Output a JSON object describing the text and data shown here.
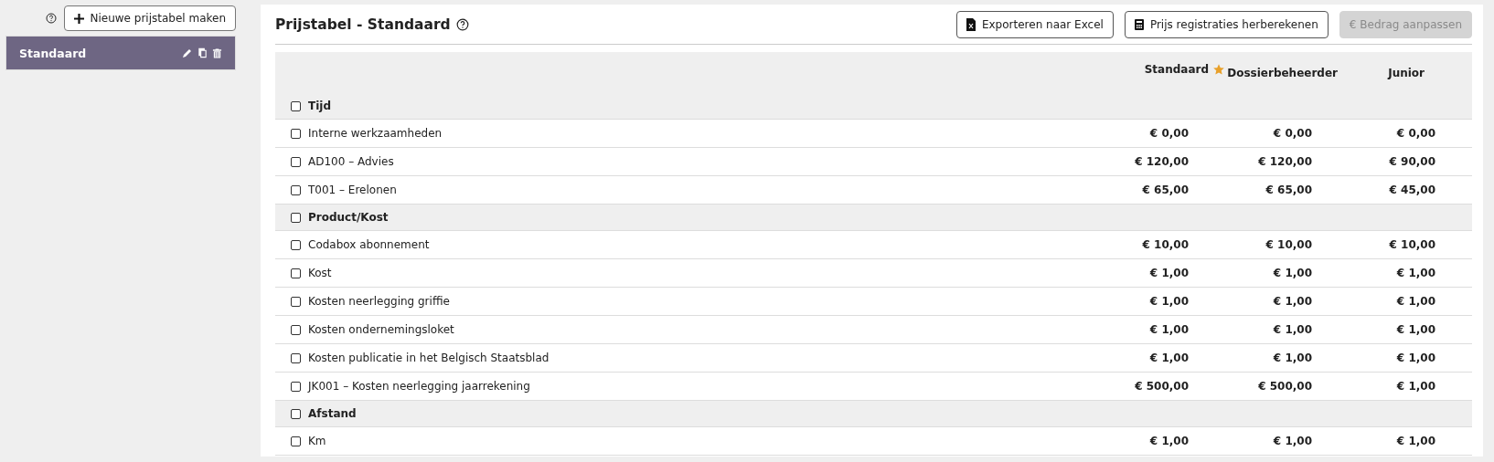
{
  "sidebar": {
    "new_button": "Nieuwe prijstabel maken",
    "items": [
      {
        "label": "Standaard",
        "selected": true
      }
    ]
  },
  "header": {
    "title": "Prijstabel - Standaard",
    "buttons": [
      {
        "label": "Exporteren naar Excel",
        "kind": "export",
        "disabled": false
      },
      {
        "label": "Prijs registraties herberekenen",
        "kind": "recalculate",
        "disabled": false
      },
      {
        "label": "€ Bedrag aanpassen",
        "kind": "amount",
        "disabled": true
      }
    ]
  },
  "table": {
    "columns": [
      {
        "label": "Standaard",
        "default": true
      },
      {
        "label": "Dossierbeheerder",
        "default": false
      },
      {
        "label": "Junior",
        "default": false
      }
    ],
    "rows": [
      {
        "kind": "group",
        "label": "Tijd",
        "checked": false
      },
      {
        "kind": "item",
        "label": "Interne werkzaamheden",
        "checked": false,
        "values": [
          "€ 0,00",
          "€ 0,00",
          "€ 0,00"
        ]
      },
      {
        "kind": "item",
        "label": "AD100 – Advies",
        "checked": false,
        "values": [
          "€ 120,00",
          "€ 120,00",
          "€ 90,00"
        ]
      },
      {
        "kind": "item",
        "label": "T001 – Erelonen",
        "checked": false,
        "values": [
          "€ 65,00",
          "€ 65,00",
          "€ 45,00"
        ]
      },
      {
        "kind": "group",
        "label": "Product/Kost",
        "checked": false
      },
      {
        "kind": "item",
        "label": "Codabox abonnement",
        "checked": false,
        "values": [
          "€ 10,00",
          "€ 10,00",
          "€ 10,00"
        ]
      },
      {
        "kind": "item",
        "label": "Kost",
        "checked": false,
        "values": [
          "€ 1,00",
          "€ 1,00",
          "€ 1,00"
        ]
      },
      {
        "kind": "item",
        "label": "Kosten neerlegging griffie",
        "checked": false,
        "values": [
          "€ 1,00",
          "€ 1,00",
          "€ 1,00"
        ]
      },
      {
        "kind": "item",
        "label": "Kosten ondernemingsloket",
        "checked": false,
        "values": [
          "€ 1,00",
          "€ 1,00",
          "€ 1,00"
        ]
      },
      {
        "kind": "item",
        "label": "Kosten publicatie in het Belgisch Staatsblad",
        "checked": false,
        "values": [
          "€ 1,00",
          "€ 1,00",
          "€ 1,00"
        ]
      },
      {
        "kind": "item",
        "label": "JK001 – Kosten neerlegging jaarrekening",
        "checked": false,
        "values": [
          "€ 500,00",
          "€ 500,00",
          "€ 1,00"
        ]
      },
      {
        "kind": "group",
        "label": "Afstand",
        "checked": false
      },
      {
        "kind": "item",
        "label": "Km",
        "checked": false,
        "values": [
          "€ 1,00",
          "€ 1,00",
          "€ 1,00"
        ]
      }
    ]
  }
}
